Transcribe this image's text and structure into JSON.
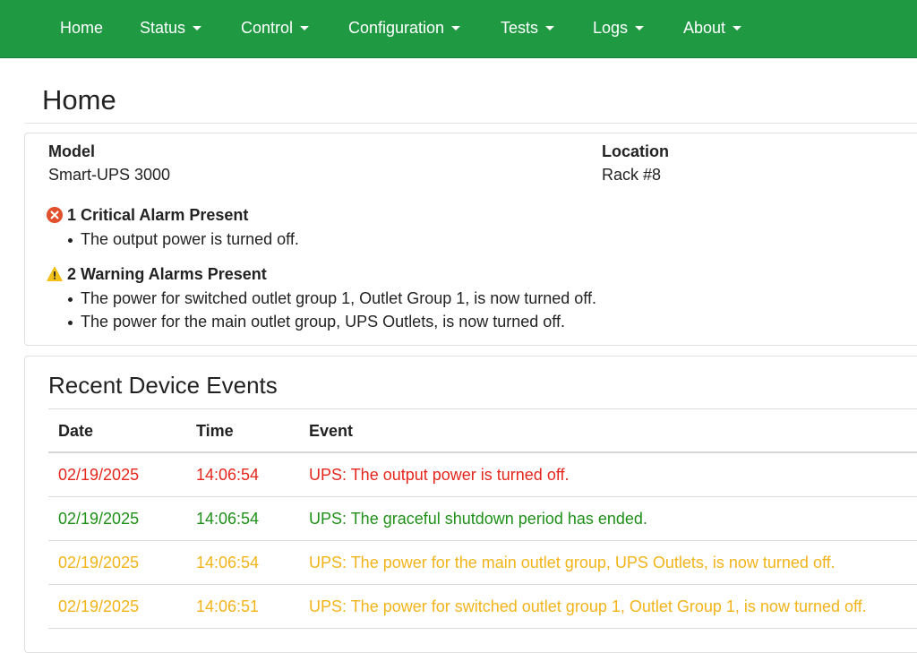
{
  "nav": {
    "items": [
      {
        "label": "Home"
      },
      {
        "label": "Status"
      },
      {
        "label": "Control"
      },
      {
        "label": "Configuration"
      },
      {
        "label": "Tests"
      },
      {
        "label": "Logs"
      },
      {
        "label": "About"
      }
    ],
    "color": "#1f9a43"
  },
  "page": {
    "title": "Home"
  },
  "summary": {
    "model_label": "Model",
    "model_value": "Smart-UPS 3000",
    "location_label": "Location",
    "location_value": "Rack #8"
  },
  "alarms": {
    "critical": {
      "icon": "error-circle-icon",
      "heading": "1 Critical Alarm Present",
      "items": [
        "The output power is turned off."
      ]
    },
    "warning": {
      "icon": "warning-triangle-icon",
      "heading": "2 Warning Alarms Present",
      "items": [
        "The power for switched outlet group 1, Outlet Group 1, is now turned off.",
        "The power for the main outlet group, UPS Outlets, is now turned off."
      ]
    }
  },
  "events": {
    "title": "Recent Device Events",
    "columns": [
      "Date",
      "Time",
      "Event"
    ],
    "rows": [
      {
        "date": "02/19/2025",
        "time": "14:06:54",
        "event": "UPS: The output power is turned off.",
        "severity": "critical",
        "color": "#e4261c"
      },
      {
        "date": "02/19/2025",
        "time": "14:06:54",
        "event": "UPS: The graceful shutdown period has ended.",
        "severity": "info",
        "color": "#1f9018"
      },
      {
        "date": "02/19/2025",
        "time": "14:06:54",
        "event": "UPS: The power for the main outlet group, UPS Outlets, is now turned off.",
        "severity": "warning",
        "color": "#f2b41a"
      },
      {
        "date": "02/19/2025",
        "time": "14:06:51",
        "event": "UPS: The power for switched outlet group 1, Outlet Group 1, is now turned off.",
        "severity": "warning",
        "color": "#f2b41a"
      }
    ]
  }
}
